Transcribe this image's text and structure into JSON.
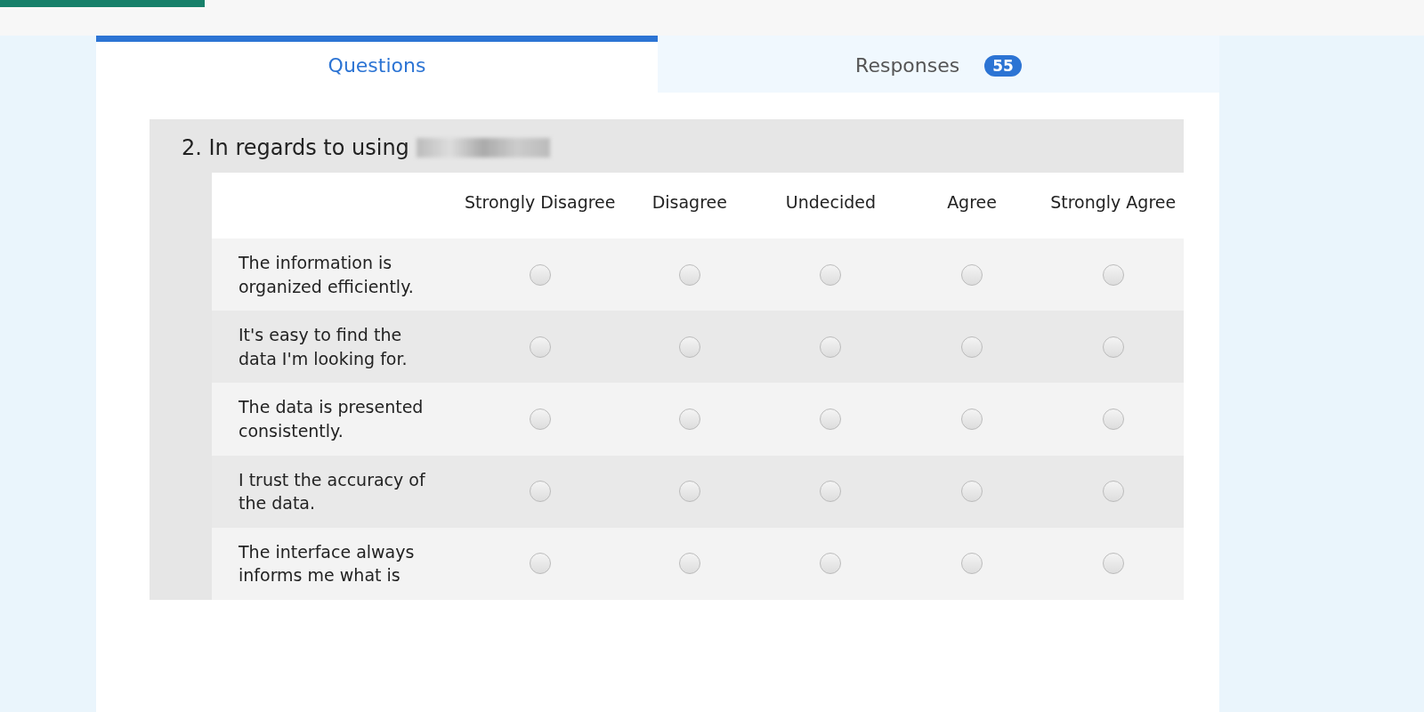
{
  "tabs": [
    {
      "label": "Questions",
      "selected": true
    },
    {
      "label": "Responses",
      "selected": false,
      "badge": "55"
    }
  ],
  "question": {
    "title": "2. In regards to using",
    "redacted": true,
    "columns": [
      "Strongly Disagree",
      "Disagree",
      "Undecided",
      "Agree",
      "Strongly Agree"
    ],
    "rows": [
      {
        "label": "The information is organized efficiently.",
        "choices": [
          false,
          false,
          false,
          false,
          false
        ]
      },
      {
        "label": "It's easy to find the data I'm looking for.",
        "choices": [
          false,
          false,
          false,
          false,
          false
        ]
      },
      {
        "label": "The data is presented consistently.",
        "choices": [
          false,
          false,
          false,
          false,
          false
        ]
      },
      {
        "label": "I trust the accuracy of the data.",
        "choices": [
          false,
          false,
          false,
          false,
          false
        ]
      },
      {
        "label": "The interface always informs me what is",
        "choices": [
          false,
          false,
          false,
          false,
          false
        ]
      }
    ]
  }
}
